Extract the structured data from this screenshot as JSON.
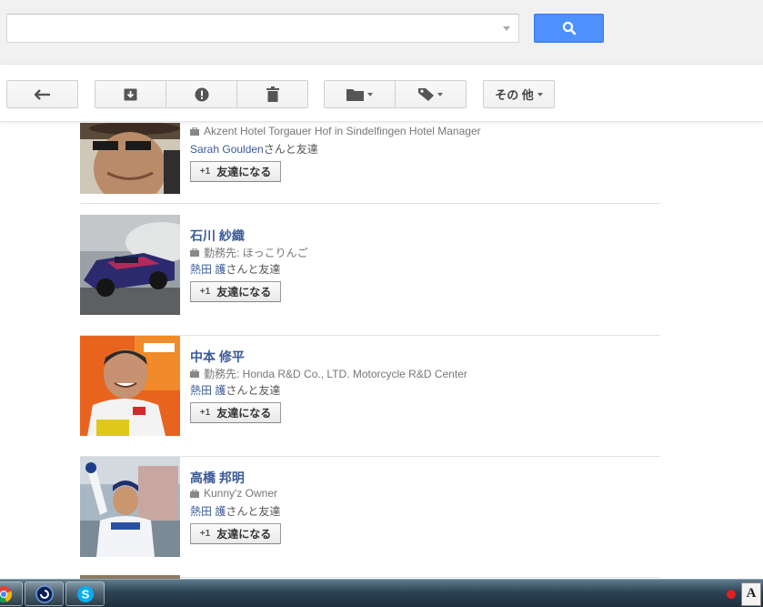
{
  "search": {
    "value": "",
    "placeholder": ""
  },
  "toolbar": {
    "buttons": [
      {
        "icon": "reply-back-icon"
      },
      {
        "icon": "archive-icon"
      },
      {
        "icon": "report-spam-icon"
      },
      {
        "icon": "trash-icon"
      },
      {
        "icon": "folder-icon"
      },
      {
        "icon": "label-tag-icon"
      }
    ],
    "more_label": "その 他"
  },
  "people": [
    {
      "name": "",
      "work": "Akzent Hotel Torgauer Hof in Sindelfingen Hotel Manager",
      "mutual_friend": "Sarah Goulden",
      "mutual_suffix": "さんと友達",
      "button_label": "友達になる",
      "button_plus": "+1"
    },
    {
      "name": "石川 紗織",
      "work": "勤務先: ほっこりんご",
      "mutual_friend": "熱田 護",
      "mutual_suffix": "さんと友達",
      "button_label": "友達になる",
      "button_plus": "+1"
    },
    {
      "name": "中本 修平",
      "work": "勤務先: Honda R&D Co., LTD. Motorcycle R&D Center",
      "mutual_friend": "熱田 護",
      "mutual_suffix": "さんと友達",
      "button_label": "友達になる",
      "button_plus": "+1"
    },
    {
      "name": "高橋 邦明",
      "work": "Kunny'z Owner",
      "mutual_friend": "熱田 護",
      "mutual_suffix": "さんと友達",
      "button_label": "友達になる",
      "button_plus": "+1"
    }
  ],
  "taskbar": {
    "items": [
      "chrome-icon",
      "app-circle-icon",
      "skype-icon"
    ],
    "ime_label": "A"
  },
  "colors": {
    "search_button": "#4d90fe",
    "link_blue": "#3b5998",
    "gray_text": "#777777"
  }
}
